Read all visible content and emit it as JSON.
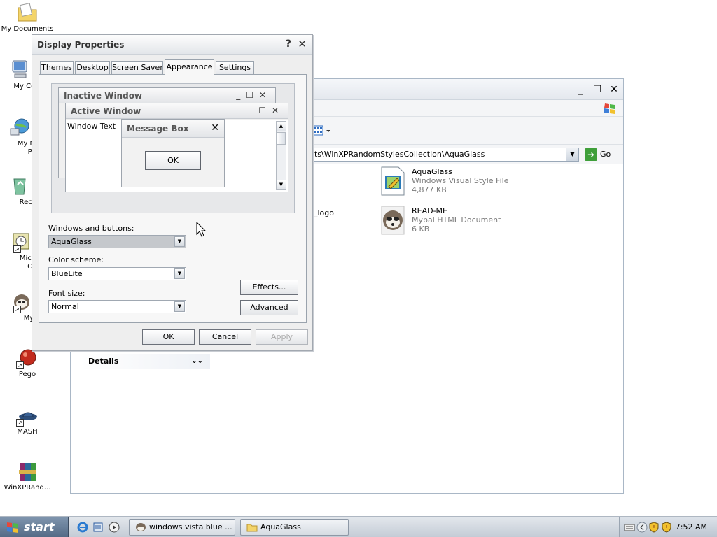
{
  "desktop": {
    "icons": [
      {
        "label": "My Documents"
      },
      {
        "label": "My Com"
      },
      {
        "label": "My Net"
      },
      {
        "label": "Plac"
      },
      {
        "label": "Recycl"
      },
      {
        "label": "Micros"
      },
      {
        "label": "Outl"
      },
      {
        "label": "MyPa"
      },
      {
        "label": "Pego"
      },
      {
        "label": "MASH"
      },
      {
        "label": "WinXPRand..."
      }
    ]
  },
  "explorer": {
    "address_path": "nts\\WinXPRandomStylesCollection\\AquaGlass",
    "go_label": "Go",
    "files": [
      {
        "name": "AquaGlass",
        "type": "Windows Visual Style File",
        "size": "4,877 KB"
      },
      {
        "name": "READ-ME",
        "type": "Mypal HTML Document",
        "size": "6 KB"
      }
    ],
    "partial_file_label": "_logo",
    "details_label": "Details"
  },
  "dialog": {
    "title": "Display Properties",
    "help_glyph": "?",
    "close_glyph": "✕",
    "tabs": [
      {
        "label": "Themes"
      },
      {
        "label": "Desktop"
      },
      {
        "label": "Screen Saver"
      },
      {
        "label": "Appearance"
      },
      {
        "label": "Settings"
      }
    ],
    "active_tab": "Appearance",
    "preview": {
      "inactive_title": "Inactive Window",
      "active_title": "Active Window",
      "window_text": "Window Text",
      "message_box_title": "Message Box",
      "message_box_ok": "OK"
    },
    "windows_buttons_label": "Windows and buttons:",
    "windows_buttons_value": "AquaGlass",
    "color_scheme_label": "Color scheme:",
    "color_scheme_value": "BlueLite",
    "font_size_label": "Font size:",
    "font_size_value": "Normal",
    "effects_label": "Effects...",
    "advanced_label": "Advanced",
    "ok_label": "OK",
    "cancel_label": "Cancel",
    "apply_label": "Apply"
  },
  "taskbar": {
    "start_label": "start",
    "tasks": [
      {
        "label": "windows vista blue ..."
      },
      {
        "label": "AquaGlass"
      }
    ],
    "clock": "7:52 AM"
  },
  "colors": {
    "go_green": "#3f9f3a",
    "start_button": "#546b86"
  }
}
